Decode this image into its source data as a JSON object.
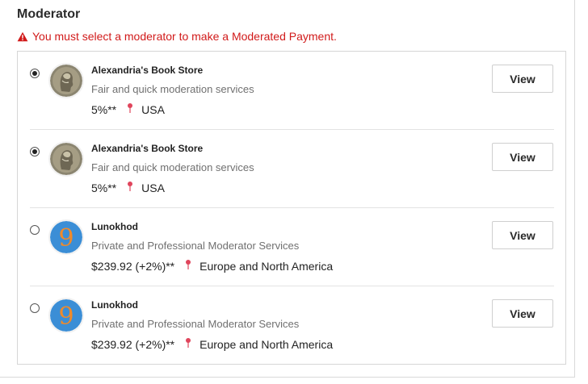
{
  "section": {
    "title": "Moderator",
    "error": "You must select a moderator to make a Moderated Payment."
  },
  "moderators": [
    {
      "name": "Alexandria's Book Store",
      "description": "Fair and quick moderation services",
      "fee": "5%**",
      "location": "USA",
      "selected": true,
      "avatar": "coin-portrait",
      "button": "View"
    },
    {
      "name": "Alexandria's Book Store",
      "description": "Fair and quick moderation services",
      "fee": "5%**",
      "location": "USA",
      "selected": true,
      "avatar": "coin-portrait",
      "button": "View"
    },
    {
      "name": "Lunokhod",
      "description": "Private and Professional Moderator Services",
      "fee": "$239.92 (+2%)**",
      "location": "Europe and North America",
      "selected": false,
      "avatar": "nine-logo",
      "button": "View"
    },
    {
      "name": "Lunokhod",
      "description": "Private and Professional Moderator Services",
      "fee": "$239.92 (+2%)**",
      "location": "Europe and North America",
      "selected": false,
      "avatar": "nine-logo",
      "button": "View"
    }
  ],
  "colors": {
    "error": "#d11a1a",
    "pin": "#e0455c",
    "nine_bg": "#3b8ed6",
    "nine_digit": "#f08a2a"
  }
}
